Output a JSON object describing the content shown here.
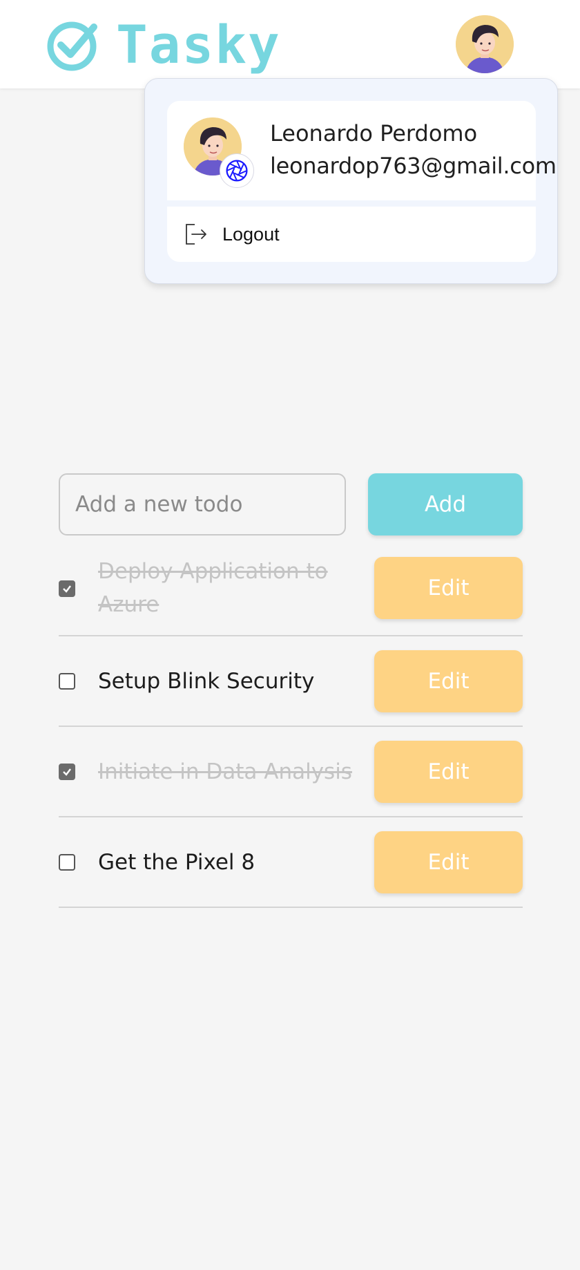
{
  "app": {
    "name": "Tasky",
    "brand_color": "#77d6df"
  },
  "header": {
    "logo_icon": "check-circle-icon",
    "avatar_icon": "user-avatar"
  },
  "user_menu": {
    "name": "Leonardo Perdomo",
    "email": "leonardop763@gmail.com",
    "provider_icon": "aperture-icon",
    "logout_label": "Logout",
    "logout_icon": "logout-icon"
  },
  "new_todo": {
    "placeholder": "Add a new todo",
    "value": "",
    "add_label": "Add"
  },
  "todos": [
    {
      "text": "Deploy Application to Azure",
      "completed": true,
      "edit_label": "Edit"
    },
    {
      "text": "Setup Blink Security",
      "completed": false,
      "edit_label": "Edit"
    },
    {
      "text": "Initiate in Data Analysis",
      "completed": true,
      "edit_label": "Edit"
    },
    {
      "text": "Get the Pixel 8",
      "completed": false,
      "edit_label": "Edit"
    }
  ],
  "colors": {
    "add_button": "#77d6df",
    "edit_button": "#fed384",
    "completed_text": "#c4c4c4",
    "background": "#f5f5f5"
  }
}
